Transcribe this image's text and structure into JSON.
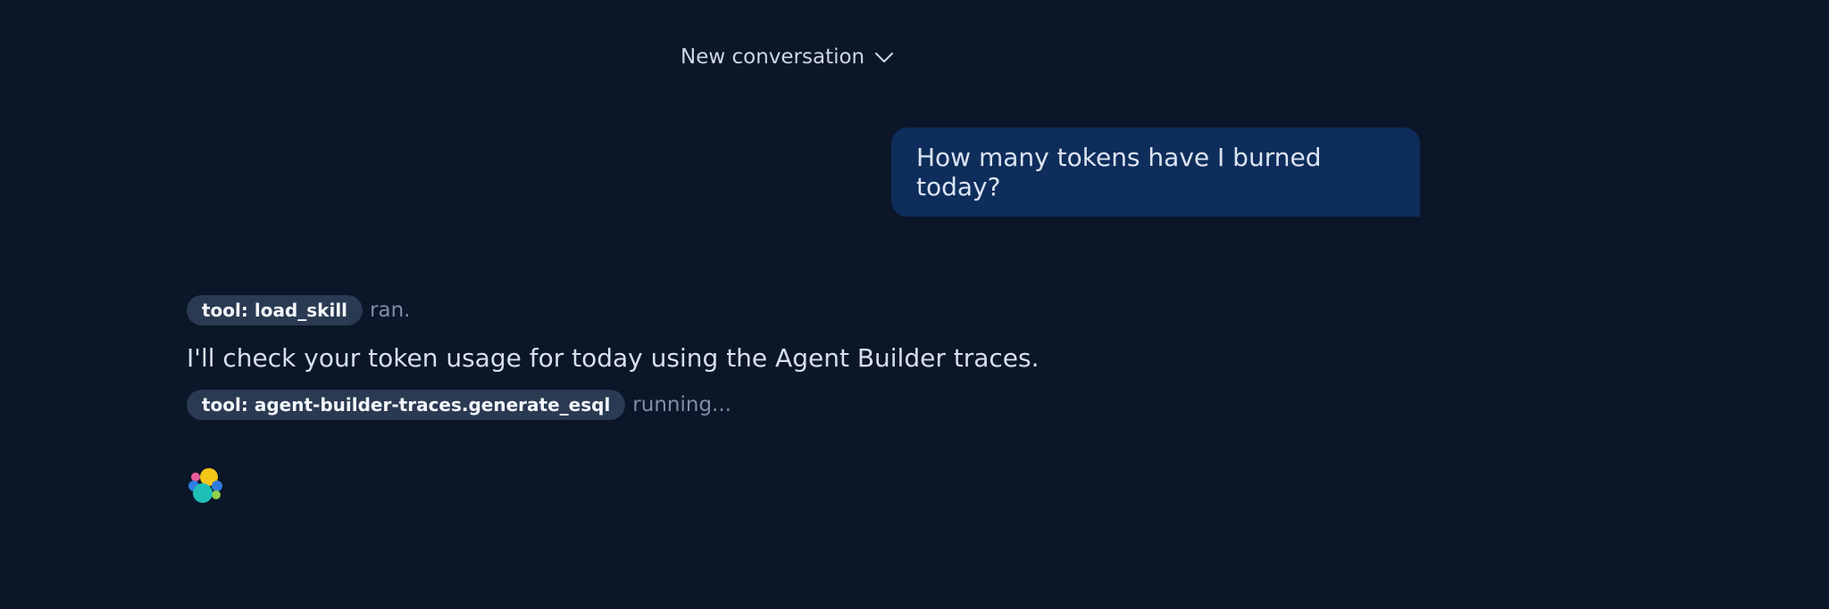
{
  "header": {
    "title": "New conversation",
    "dropdown_icon": "chevron-down-icon"
  },
  "conversation": {
    "user_message": "How many tokens have I burned today?",
    "assistant": {
      "steps": [
        {
          "tool_label": "tool: load_skill",
          "status": "ran."
        },
        {
          "tool_label": "tool: agent-builder-traces.generate_esql",
          "status": "running..."
        }
      ],
      "text": "I'll check your token usage for today using the Agent Builder traces.",
      "avatar_icon": "elastic-logo-icon"
    }
  },
  "colors": {
    "background": "#0b1628",
    "user_bubble": "#0e2d5b",
    "tool_pill": "#2a3a52",
    "status_text": "#7f8da5",
    "logo_yellow": "#f5c518",
    "logo_teal": "#1fbfb8",
    "logo_blue": "#2f7de1",
    "logo_pink": "#e85c9a",
    "logo_green": "#8fd14f"
  }
}
